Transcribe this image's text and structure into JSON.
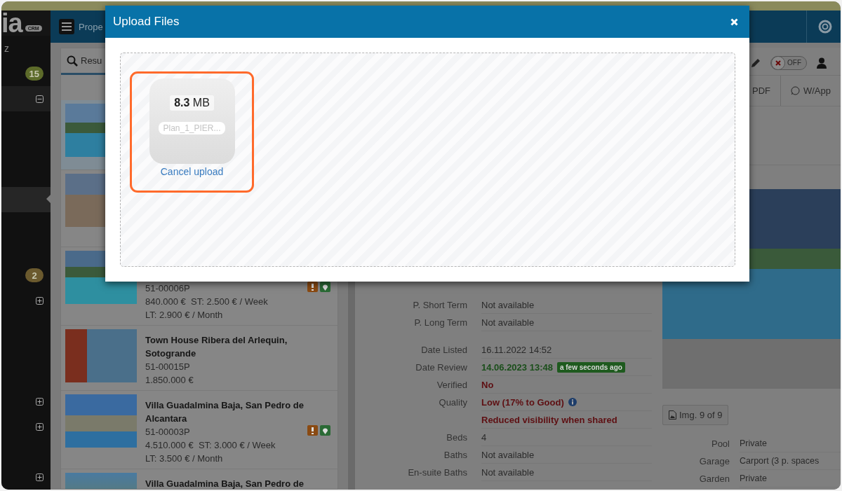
{
  "sidebar": {
    "logo": "ia",
    "logo_badge": "CRM",
    "rows": [
      {
        "kind": "text",
        "text": "z",
        "selected": false
      },
      {
        "kind": "badge",
        "text": "15",
        "color": "#5d6b2a",
        "selected": false
      },
      {
        "kind": "toggle",
        "expanded": true,
        "selected": false
      },
      {
        "kind": "blank",
        "selected": false
      },
      {
        "kind": "blank",
        "selected": false
      },
      {
        "kind": "blank",
        "selected": false
      },
      {
        "kind": "blank",
        "selected": true
      },
      {
        "kind": "blank",
        "selected": false
      },
      {
        "kind": "blank",
        "selected": false
      },
      {
        "kind": "badge",
        "text": "2",
        "color": "#6b5a2e",
        "selected": false
      },
      {
        "kind": "toggle",
        "expanded": false,
        "selected": false
      },
      {
        "kind": "blank",
        "selected": false
      },
      {
        "kind": "blank",
        "selected": false
      },
      {
        "kind": "blank",
        "selected": false
      },
      {
        "kind": "toggle",
        "expanded": false,
        "selected": false
      },
      {
        "kind": "toggle",
        "expanded": false,
        "selected": false
      },
      {
        "kind": "blank",
        "selected": false
      },
      {
        "kind": "toggle",
        "expanded": false,
        "selected": false
      }
    ]
  },
  "topbar": {
    "title": "Prope"
  },
  "results_tab": {
    "label": "Resu",
    "selected": true
  },
  "listings": [
    {
      "selected": true
    },
    {
      "selected": false
    },
    {
      "selected": false,
      "ref": "51-00006P",
      "price": "840.000 €  ST: 2.500 € / Week",
      "price_2": "LT: 2.900 € / Month",
      "flags": true
    },
    {
      "selected": false,
      "title": "Town House Ribera del Arlequin, Sotogrande",
      "ref": "51-00015P",
      "price": "1.850.000 €",
      "flags": false
    },
    {
      "selected": false,
      "title": "Villa Guadalmina Baja, San Pedro de Alcantara",
      "ref": "51-00003P",
      "price": "4.510.000 €  ST: 3.000 € / Week",
      "price_2": "LT: 3.500 € / Month",
      "flags": true
    },
    {
      "selected": false,
      "title": "Villa Guadalmina Baja, San Pedro de",
      "flags": false
    }
  ],
  "toolbar": {
    "toggle_label": "OFF",
    "toggle_on": false,
    "buttons": [
      "PDF",
      "W/App"
    ]
  },
  "details": {
    "groups": [
      {
        "rows": [
          {
            "label": "P. Short Term",
            "value": "Not available",
            "good": false,
            "bad": false
          },
          {
            "label": "P. Long Term",
            "value": "Not available",
            "good": false,
            "bad": false
          }
        ]
      },
      {
        "rows": [
          {
            "label": "Date Listed",
            "value": "16.11.2022 14:52",
            "good": false,
            "bad": false
          },
          {
            "label": "Date Review",
            "value": "14.06.2023 13:48",
            "good": true,
            "bad": false,
            "badge": "a few seconds ago"
          },
          {
            "label": "Verified",
            "value": "No",
            "good": false,
            "bad": true
          },
          {
            "label": "Quality",
            "value": "Low (17% to Good)",
            "good": false,
            "bad": true,
            "info": true
          },
          {
            "value": "Reduced visibility when shared",
            "good": false,
            "bad": true
          },
          {
            "label": "Beds",
            "value": "4",
            "good": false,
            "bad": false
          },
          {
            "label": "Baths",
            "value": "Not available",
            "good": false,
            "bad": false
          },
          {
            "label": "En-suite Baths",
            "value": "Not available",
            "good": false,
            "bad": false
          }
        ]
      }
    ],
    "image_counter": "Img. 9 of 9",
    "features": [
      {
        "label": "Pool",
        "value": "Private"
      },
      {
        "label": "Garage",
        "value": "Carport (3 p. spaces"
      },
      {
        "label": "Garden",
        "value": "Private"
      }
    ]
  },
  "modal": {
    "title": "Upload Files",
    "file": {
      "size_number": "8.3",
      "size_unit": "MB",
      "name": "Plan_1_PIER...",
      "action": "Cancel upload",
      "highlighted": true
    }
  }
}
